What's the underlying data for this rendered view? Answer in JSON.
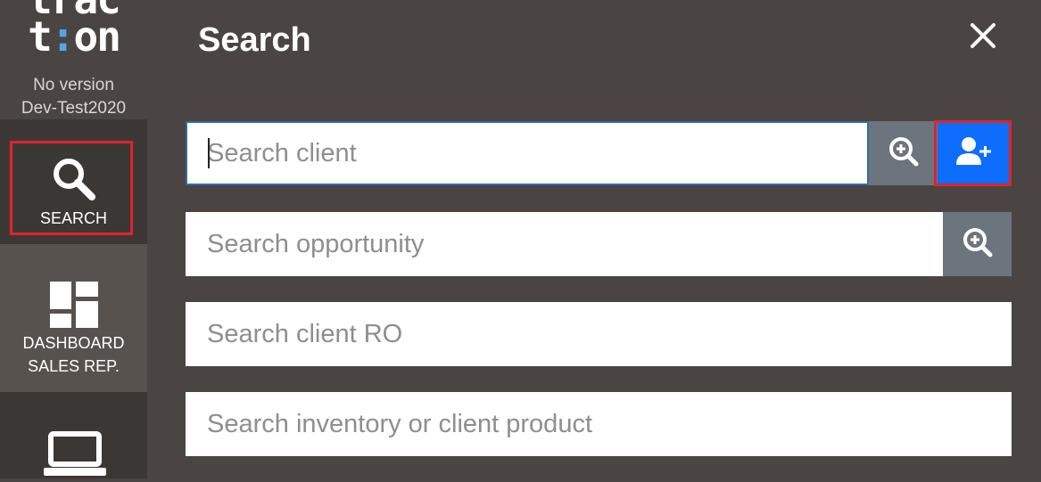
{
  "sidebar": {
    "logo_line1": "trac",
    "logo_line2_a": "t",
    "logo_line2_accent": ":",
    "logo_line2_b": "on",
    "version": "No version",
    "environment": "Dev-Test2020",
    "items": [
      {
        "label": "SEARCH",
        "icon": "search-icon",
        "selected": true
      },
      {
        "label_line1": "DASHBOARD",
        "label_line2": "SALES REP.",
        "icon": "dashboard-icon"
      },
      {
        "label": "",
        "icon": "laptop-icon"
      }
    ]
  },
  "header": {
    "title": "Search",
    "close_icon": "close-icon"
  },
  "search": {
    "client_placeholder": "Search client",
    "opportunity_placeholder": "Search opportunity",
    "client_ro_placeholder": "Search client RO",
    "inventory_placeholder": "Search inventory or client product"
  },
  "colors": {
    "background": "#4a4542",
    "sidebar": "#3b3735",
    "accent_blue": "#0d6efd",
    "gray_button": "#6c757d",
    "highlight_red": "#e1232b",
    "logo_accent": "#4fa7e8"
  }
}
